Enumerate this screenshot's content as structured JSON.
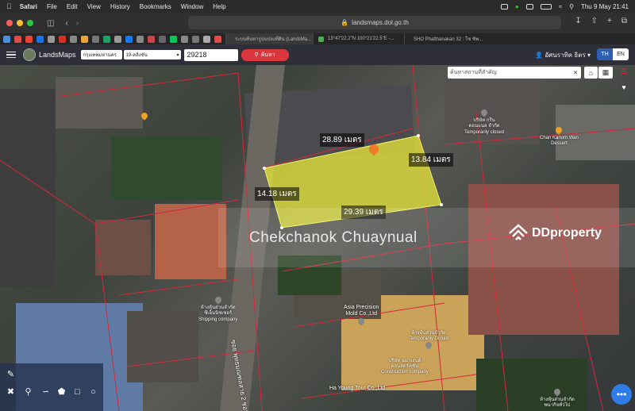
{
  "menubar": {
    "app": "Safari",
    "items": [
      "File",
      "Edit",
      "View",
      "History",
      "Bookmarks",
      "Window",
      "Help"
    ],
    "clock": "Thu 9 May  21:41"
  },
  "browser": {
    "url": "landsmaps.dol.go.th",
    "tabs": [
      {
        "label": "ระบบค้นหารูปแปลงที่ดิน (LandsMa...",
        "active": true
      },
      {
        "label": "13°47'22.2\"N 100°21'22.5\"E -..."
      },
      {
        "label": "SHO Phatthanakan 32 : โซ ซิพ..."
      }
    ]
  },
  "app": {
    "name": "LandsMaps",
    "province": "กรุงเทพมหานคร",
    "district": "19-ตลิ่งชัน",
    "parcel_query": "29218",
    "search_label": "ค้นหา",
    "user": "อัศนราทิค ธิตร",
    "lang_th": "TH",
    "lang_en": "EN"
  },
  "map": {
    "place_search_placeholder": "ค้นหาสถานที่สำคัญ",
    "dimensions": {
      "top": "28.89 เมตร",
      "right": "13.84 เมตร",
      "left": "14.18 เมตร",
      "bottom": "29.39 เมตร"
    },
    "parcel_color": "#e8e83a",
    "watermark": "Chekchanok Chuaynual",
    "brand": "DDproperty",
    "pois": [
      {
        "label": "บริษัท กรีน\nดอนแนล จำกัด\nTemporarily closed"
      },
      {
        "label": "Chan Kanom Wan\nDessert"
      },
      {
        "label": "ห้างหุ้นส่วนจำกัด\nซีเอ็นนิชเชอร์\nShipping company"
      },
      {
        "label": "Asia Precision\nMold Co.,Ltd"
      },
      {
        "label": "ห้างหุ้นส่วนจำกัด\nTemporarily closed"
      },
      {
        "label": "บริษัท ฉมาเงนต์\nคอนสตรัคชั่น\nConstruction company"
      },
      {
        "label": "Ha Young Tour Co.,Ltd"
      },
      {
        "label": "ห้างหุ้นส่วนจำกัด\nพนากิจทั่วไป"
      }
    ],
    "road_label": "ซอย พุทธมณฑลสาย 2 ซอย 24"
  }
}
